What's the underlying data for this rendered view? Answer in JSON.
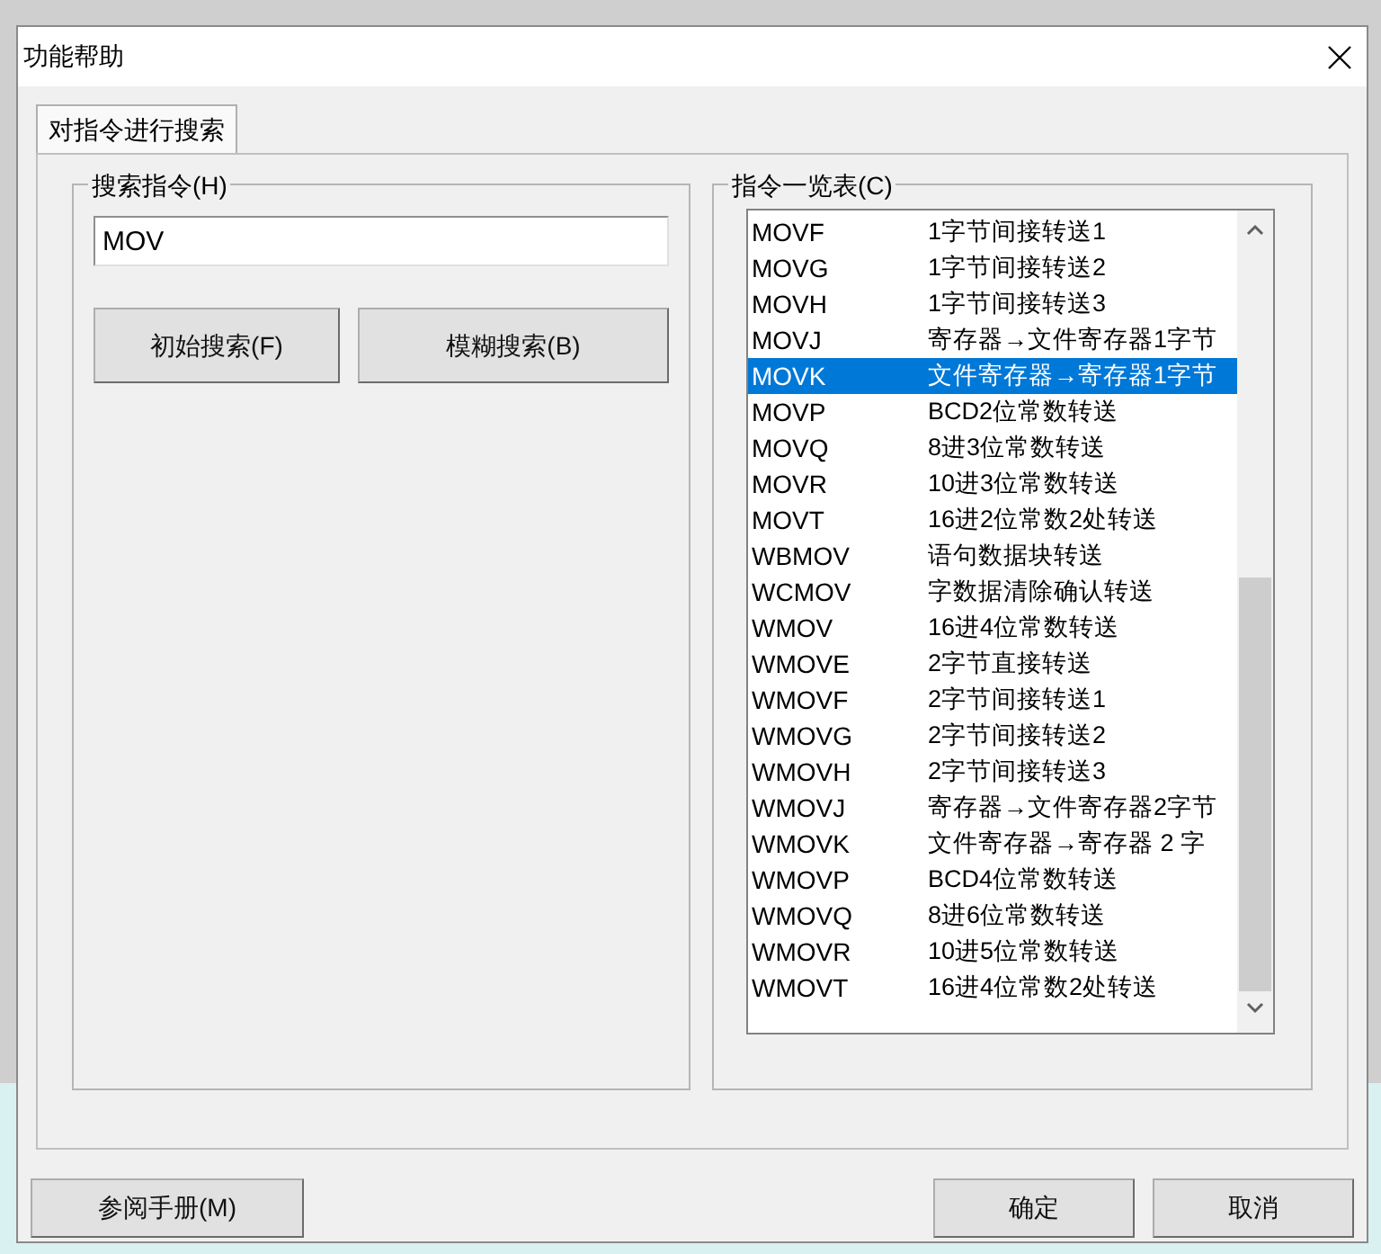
{
  "window": {
    "title": "功能帮助"
  },
  "tabs": [
    {
      "label": "对指令进行搜索",
      "selected": true
    }
  ],
  "search_group": {
    "title": "搜索指令(H)",
    "field_value": "MOV",
    "buttons": [
      "初始搜索(F)",
      "模糊搜索(B)"
    ]
  },
  "list_group": {
    "title": "指令一览表(C)",
    "rows": [
      {
        "code": "MOVF",
        "description": "1字节间接转送1",
        "selected": false
      },
      {
        "code": "MOVG",
        "description": "1字节间接转送2",
        "selected": false
      },
      {
        "code": "MOVH",
        "description": "1字节间接转送3",
        "selected": false
      },
      {
        "code": "MOVJ",
        "description": "寄存器→文件寄存器1字节",
        "selected": false
      },
      {
        "code": "MOVK",
        "description": "文件寄存器→寄存器1字节",
        "selected": true
      },
      {
        "code": "MOVP",
        "description": "BCD2位常数转送",
        "selected": false
      },
      {
        "code": "MOVQ",
        "description": "8进3位常数转送",
        "selected": false
      },
      {
        "code": "MOVR",
        "description": "10进3位常数转送",
        "selected": false
      },
      {
        "code": "MOVT",
        "description": "16进2位常数2处转送",
        "selected": false
      },
      {
        "code": "WBMOV",
        "description": "语句数据块转送",
        "selected": false
      },
      {
        "code": "WCMOV",
        "description": "字数据清除确认转送",
        "selected": false
      },
      {
        "code": "WMOV",
        "description": "16进4位常数转送",
        "selected": false
      },
      {
        "code": "WMOVE",
        "description": "2字节直接转送",
        "selected": false
      },
      {
        "code": "WMOVF",
        "description": "2字节间接转送1",
        "selected": false
      },
      {
        "code": "WMOVG",
        "description": "2字节间接转送2",
        "selected": false
      },
      {
        "code": "WMOVH",
        "description": "2字节间接转送3",
        "selected": false
      },
      {
        "code": "WMOVJ",
        "description": "寄存器→文件寄存器2字节",
        "selected": false
      },
      {
        "code": "WMOVK",
        "description": "文件寄存器→寄存器 2 字",
        "selected": false
      },
      {
        "code": "WMOVP",
        "description": "BCD4位常数转送",
        "selected": false
      },
      {
        "code": "WMOVQ",
        "description": "8进6位常数转送",
        "selected": false
      },
      {
        "code": "WMOVR",
        "description": "10进5位常数转送",
        "selected": false
      },
      {
        "code": "WMOVT",
        "description": "16进4位常数2处转送",
        "selected": false
      }
    ]
  },
  "footer_buttons": [
    {
      "label": "参阅手册(M)",
      "kind": "left"
    },
    {
      "label": "确定",
      "kind": "right"
    },
    {
      "label": "取消",
      "kind": "right"
    }
  ]
}
